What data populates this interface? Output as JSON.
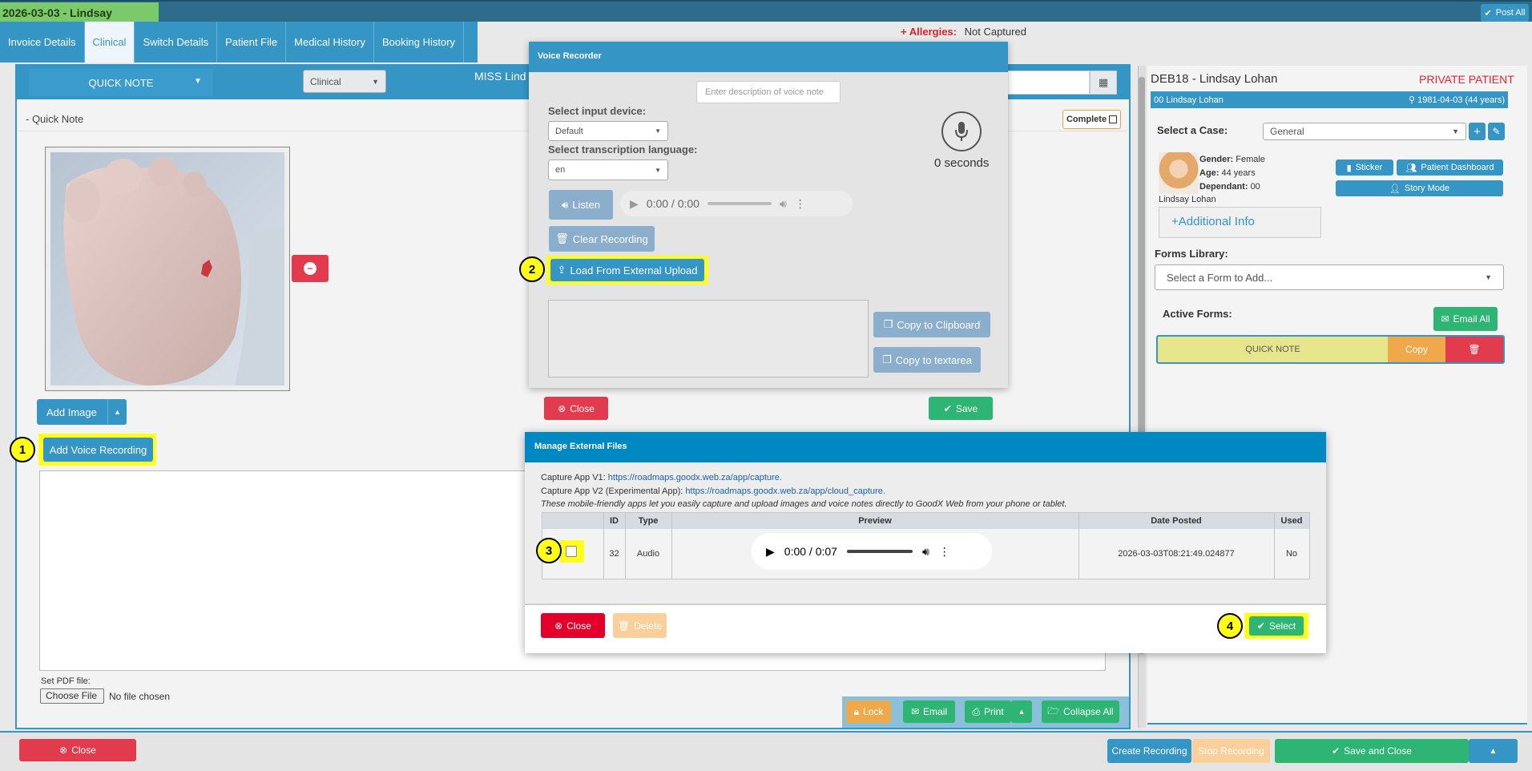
{
  "topbar": {
    "title": "2026-03-03 - Lindsay",
    "post_all": "Post All"
  },
  "tabs": [
    "Invoice Details",
    "Clinical",
    "Switch Details",
    "Patient File",
    "Medical History",
    "Booking History"
  ],
  "allergies": {
    "label": "Allergies:",
    "value": "Not Captured"
  },
  "note_header": {
    "quick_note": "QUICK NOTE",
    "type_select": "Clinical",
    "patient_title": "MISS Lind"
  },
  "section": {
    "title": "- Quick Note",
    "complete": "Complete"
  },
  "add_image": "Add Image",
  "add_voice": "Add Voice Recording",
  "pdf": {
    "label": "Set PDF file:",
    "button": "Choose File",
    "status": "No file chosen"
  },
  "footer_actions": {
    "lock": "Lock",
    "email": "Email",
    "print": "Print",
    "collapse": "Collapse All"
  },
  "bottom_bar": {
    "close": "Close",
    "create_recording": "Create Recording",
    "stop_recording": "Stop Recording",
    "save_close": "Save and Close"
  },
  "voice_recorder": {
    "title": "Voice Recorder",
    "desc_placeholder": "Enter description of voice note",
    "input_label": "Select input device:",
    "input_value": "Default",
    "lang_label": "Select transcription language:",
    "lang_value": "en",
    "seconds": "0 seconds",
    "listen": "Listen",
    "player_time": "0:00 / 0:00",
    "clear": "Clear Recording",
    "load_external": "Load From External Upload",
    "copy_clipboard": "Copy to Clipboard",
    "copy_textarea": "Copy to textarea",
    "close": "Close",
    "save": "Save"
  },
  "manage_files": {
    "title": "Manage External Files",
    "v1_label": "Capture App V1:",
    "v1_link": "https://roadmaps.goodx.web.za/app/capture.",
    "v2_label": "Capture App V2 (Experimental App):",
    "v2_link": "https://roadmaps.goodx.web.za/app/cloud_capture.",
    "note": "These mobile-friendly apps let you easily capture and upload images and voice notes directly to GoodX Web from your phone or tablet.",
    "columns": [
      "",
      "ID",
      "Type",
      "Preview",
      "Date Posted",
      "Used"
    ],
    "row": {
      "id": "32",
      "type": "Audio",
      "player_time": "0:00 / 0:07",
      "date": "2026-03-03T08:21:49.024877",
      "used": "No"
    },
    "close": "Close",
    "delete": "Delete",
    "select": "Select"
  },
  "patient": {
    "code_name": "DEB18 - Lindsay Lohan",
    "private": "PRIVATE PATIENT",
    "bar_left": "00 Lindsay Lohan",
    "bar_right": "1981-04-03 (44 years)",
    "case_label": "Select a Case:",
    "case_value": "General",
    "gender_label": "Gender:",
    "gender": "Female",
    "age_label": "Age:",
    "age": "44 years",
    "dependant_label": "Dependant:",
    "dependant": "00",
    "name": "Lindsay Lohan",
    "sticker": "Sticker",
    "dashboard": "Patient Dashboard",
    "story": "Story Mode",
    "additional": "+Additional Info",
    "forms_label": "Forms Library:",
    "forms_placeholder": "Select a Form to Add...",
    "active_forms": "Active Forms:",
    "email_all": "Email All",
    "form_name": "QUICK NOTE",
    "form_copy": "Copy"
  },
  "steps": [
    "1",
    "2",
    "3",
    "4"
  ]
}
